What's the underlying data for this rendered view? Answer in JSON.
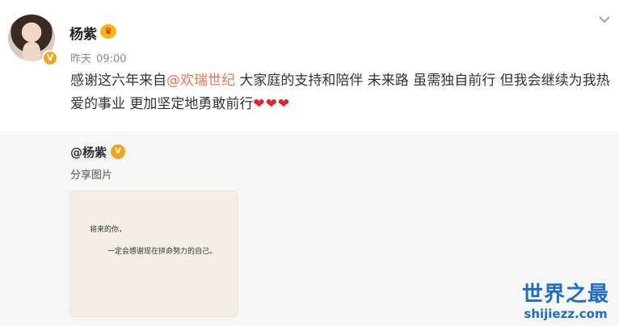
{
  "post": {
    "username": "杨紫",
    "time_day": "昨天",
    "time_clock": "09:00",
    "text_before": "感谢这六年来自",
    "mention": "@欢瑞世纪",
    "text_after": " 大家庭的支持和陪伴 未来路 虽需独自前行 但我会继续为我热爱的事业 更加坚定地勇敢前行",
    "hearts": "❤❤❤",
    "badge": "V"
  },
  "repost": {
    "username": "@杨紫",
    "badge": "V",
    "text": "分享图片",
    "image_line1": "将来的你，",
    "image_line2": "一定会感谢现在拼命努力的自己。"
  },
  "watermark": {
    "title": "世界之最",
    "url": "shijiezz.com"
  },
  "colors": {
    "mention": "#eb7350",
    "heart": "#e0242a",
    "badge": "#f7a21b",
    "watermark": "#1e6ec8"
  }
}
